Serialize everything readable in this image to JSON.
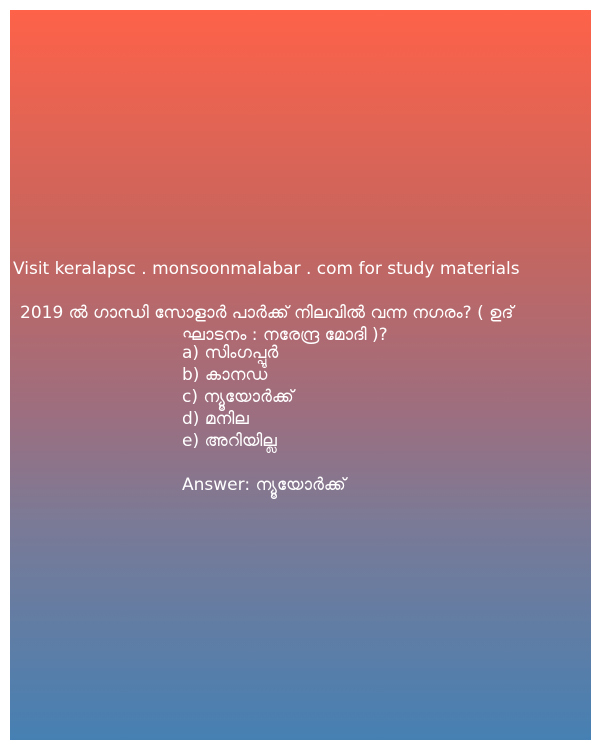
{
  "site_line": "Visit keralapsc . monsoonmalabar . com for study materials",
  "question": {
    "line1": "2019  ൽ ഗാന്ധി സോളാർ പാർക്ക് നിലവിൽ വന്ന നഗരം? ( ഉദ്",
    "line2": "ഘാടനം : നരേന്ദ്ര മോദി )?"
  },
  "options": [
    "a) സിംഗപ്പൂർ",
    "b) കാനഡ",
    "c) ന്യൂയോർക്ക്",
    "d) മനില",
    "e) അറിയില്ല"
  ],
  "answer": "Answer: ന്യൂയോർക്ക്",
  "colors": {
    "gradient_top": "#fe6249",
    "gradient_bottom": "#4680b3",
    "text": "#ffffff"
  }
}
